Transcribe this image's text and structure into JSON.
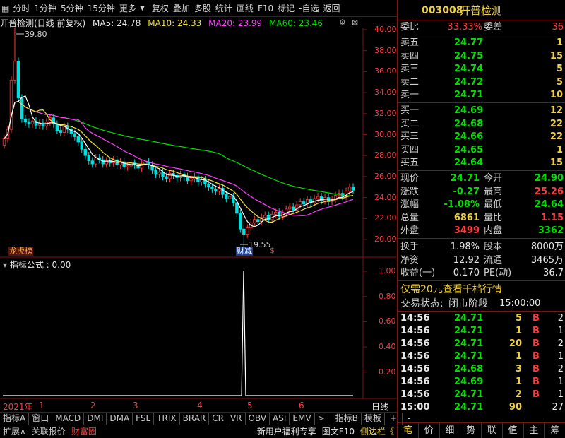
{
  "toolbar": {
    "items": [
      "分时",
      "1分钟",
      "5分钟",
      "15分钟",
      "更多",
      "复权",
      "叠加",
      "多股",
      "统计",
      "画线",
      "F10",
      "标记",
      "-自选",
      "返回"
    ]
  },
  "title": {
    "stock": "开普检测(日线 前复权)",
    "ma5": "MA5: 24.78",
    "ma10": "MA10: 24.33",
    "ma20": "MA20: 23.99",
    "ma60": "MA60: 23.46"
  },
  "price_axis": [
    "40.00",
    "38.00",
    "36.00",
    "34.00",
    "32.00",
    "30.00",
    "28.00",
    "26.00",
    "24.00",
    "22.00",
    "20.00"
  ],
  "annot": {
    "high": "39.80",
    "low": "19.55",
    "tag_left": "龙虎榜",
    "tag_mid": "财减"
  },
  "indicator": {
    "name": "指标公式 : 0.00",
    "axis": [
      "1.00",
      "0.80",
      "0.60",
      "0.40",
      "0.20"
    ]
  },
  "time_axis": {
    "year": "2021年",
    "months": [
      "1",
      "2",
      "3",
      "4",
      "5",
      "6"
    ],
    "right": "日线"
  },
  "bottom_tabs": [
    "指标A",
    "窗口",
    "MACD",
    "DMI",
    "DMA",
    "FSL",
    "TRIX",
    "BRAR",
    "CR",
    "VR",
    "OBV",
    "ASI",
    "EMV",
    ">",
    "指标B",
    "模板",
    "+",
    "-"
  ],
  "bottom_bar": {
    "left": [
      "扩展∧",
      "关联报价",
      "财富圈"
    ],
    "right": [
      "新用户福利专享",
      "图文F10",
      "侧边栏《"
    ]
  },
  "quote": {
    "code": "003008",
    "name": "开普检测",
    "weibi_label": "委比",
    "weibi": "33.33%",
    "weicha_label": "委差",
    "weicha": "36",
    "sells": [
      {
        "label": "卖五",
        "price": "24.77",
        "vol": "1"
      },
      {
        "label": "卖四",
        "price": "24.75",
        "vol": "15"
      },
      {
        "label": "卖三",
        "price": "24.74",
        "vol": "5"
      },
      {
        "label": "卖二",
        "price": "24.72",
        "vol": "5"
      },
      {
        "label": "卖一",
        "price": "24.71",
        "vol": "10"
      }
    ],
    "buys": [
      {
        "label": "买一",
        "price": "24.69",
        "vol": "12"
      },
      {
        "label": "买二",
        "price": "24.68",
        "vol": "22"
      },
      {
        "label": "买三",
        "price": "24.66",
        "vol": "22"
      },
      {
        "label": "买四",
        "price": "24.65",
        "vol": "1"
      },
      {
        "label": "买五",
        "price": "24.64",
        "vol": "15"
      }
    ],
    "stats": [
      {
        "l1": "现价",
        "v1": "24.71",
        "l2": "今开",
        "v2": "24.90"
      },
      {
        "l1": "涨跌",
        "v1": "-0.27",
        "l2": "最高",
        "v2": "25.26"
      },
      {
        "l1": "涨幅",
        "v1": "-1.08%",
        "l2": "最低",
        "v2": "24.64"
      },
      {
        "l1": "总量",
        "v1": "6861",
        "l2": "量比",
        "v2": "1.15"
      },
      {
        "l1": "外盘",
        "v1": "3499",
        "l2": "内盘",
        "v2": "3362"
      }
    ],
    "fund": [
      {
        "l1": "换手",
        "v1": "1.98%",
        "l2": "股本",
        "v2": "8000万"
      },
      {
        "l1": "净资",
        "v1": "12.92",
        "l2": "流通",
        "v2": "3465万"
      },
      {
        "l1": "收益(一)",
        "v1": "0.170",
        "l2": "PE(动)",
        "v2": "36.7"
      }
    ],
    "promo": "仅需20元查看千档行情",
    "status_label": "交易状态:",
    "status": "闭市阶段",
    "status_time": "15:00:00",
    "ticks": [
      {
        "t": "14:56",
        "p": "24.71",
        "v": "5",
        "s": "B",
        "n": "2"
      },
      {
        "t": "14:56",
        "p": "24.71",
        "v": "1",
        "s": "B",
        "n": "1"
      },
      {
        "t": "14:56",
        "p": "24.71",
        "v": "20",
        "s": "B",
        "n": "2"
      },
      {
        "t": "14:56",
        "p": "24.71",
        "v": "1",
        "s": "B",
        "n": "1"
      },
      {
        "t": "14:56",
        "p": "24.68",
        "v": "3",
        "s": "B",
        "n": "2"
      },
      {
        "t": "14:56",
        "p": "24.69",
        "v": "1",
        "s": "B",
        "n": "1"
      },
      {
        "t": "14:56",
        "p": "24.71",
        "v": "2",
        "s": "B",
        "n": "1"
      },
      {
        "t": "15:00",
        "p": "24.71",
        "v": "90",
        "s": "",
        "n": "27"
      }
    ],
    "tabs": [
      "笔",
      "价",
      "细",
      "势",
      "联",
      "值",
      "主",
      "筹"
    ]
  },
  "colors": {
    "up": "#ff3b3b",
    "down": "#00e000",
    "ma5": "#ffffff",
    "ma10": "#f0e040",
    "ma20": "#ff40ff",
    "ma60": "#00e000",
    "border": "#7a1515"
  }
}
